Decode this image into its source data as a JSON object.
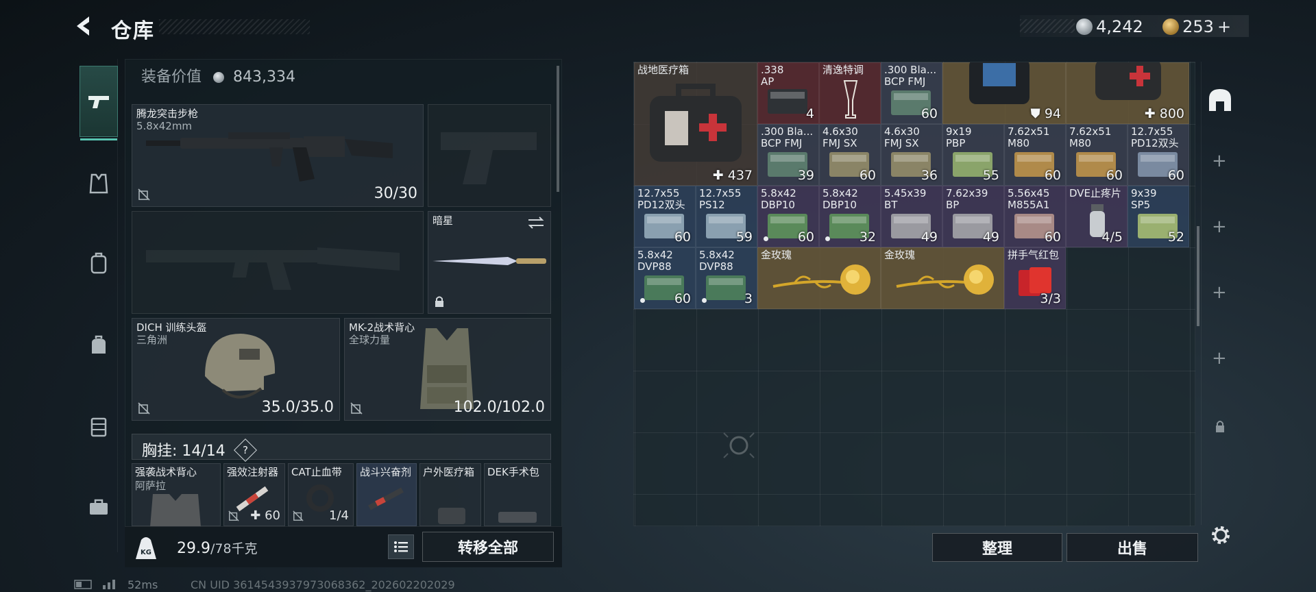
{
  "header": {
    "title": "仓库",
    "currency_silver": "4,242",
    "currency_gold": "253",
    "add_label": "+"
  },
  "nav": {
    "items": [
      "weapon-icon",
      "armor-vest-icon",
      "backpack-icon",
      "bag-icon",
      "case-icon",
      "toolbox-icon"
    ],
    "active": "weapon-icon"
  },
  "equipment": {
    "value_label": "装备价值",
    "value": "843,334",
    "primary": {
      "name": "腾龙突击步枪",
      "sub": "5.8x42mm",
      "count": "30/30"
    },
    "melee": {
      "name": "暗星"
    },
    "helmet": {
      "name": "DICH 训练头盔",
      "sub": "三角洲",
      "count": "35.0/35.0"
    },
    "vest": {
      "name": "MK-2战术背心",
      "sub": "全球力量",
      "count": "102.0/102.0"
    },
    "chest_label": "胸挂: 14/14",
    "chest_help": "?",
    "chest_items": [
      {
        "name": "强袭战术背心",
        "sub": "阿萨拉",
        "count": ""
      },
      {
        "name": "强效注射器",
        "sub": "",
        "count": "60"
      },
      {
        "name": "CAT止血带",
        "sub": "",
        "count": "1/4"
      },
      {
        "name": "战斗兴奋剂",
        "sub": "",
        "count": ""
      },
      {
        "name": "户外医疗箱",
        "sub": "",
        "count": ""
      },
      {
        "name": "DEK手术包",
        "sub": "",
        "count": ""
      }
    ],
    "weight": "29.9",
    "weight_max": "/78千克",
    "transfer_all": "转移全部"
  },
  "warehouse": {
    "items": [
      {
        "n1": "战地医疗箱",
        "n2": "",
        "count": "437",
        "icon": "plus"
      },
      {
        "n1": ".338",
        "n2": "AP",
        "count": "4"
      },
      {
        "n1": "清逸特调",
        "n2": "",
        "count": ""
      },
      {
        "n1": ".300 Bla...",
        "n2": "BCP FMJ",
        "count": "60"
      },
      {
        "n1": "",
        "n2": "",
        "count": "94",
        "icon": "shield"
      },
      {
        "n1": "",
        "n2": "",
        "count": "800",
        "icon": "plus"
      },
      {
        "n1": ".300 Bla...",
        "n2": "BCP FMJ",
        "count": "39"
      },
      {
        "n1": "4.6x30",
        "n2": "FMJ SX",
        "count": "60"
      },
      {
        "n1": "4.6x30",
        "n2": "FMJ SX",
        "count": "36"
      },
      {
        "n1": "9x19",
        "n2": "PBP",
        "count": "55"
      },
      {
        "n1": "7.62x51",
        "n2": "M80",
        "count": "60"
      },
      {
        "n1": "7.62x51",
        "n2": "M80",
        "count": "60"
      },
      {
        "n1": "12.7x55",
        "n2": "PD12双头",
        "count": "60"
      },
      {
        "n1": "12.7x55",
        "n2": "PD12双头",
        "count": "60"
      },
      {
        "n1": "12.7x55",
        "n2": "PS12",
        "count": "59"
      },
      {
        "n1": "5.8x42",
        "n2": "DBP10",
        "count": "60"
      },
      {
        "n1": "5.8x42",
        "n2": "DBP10",
        "count": "32"
      },
      {
        "n1": "5.45x39",
        "n2": "BT",
        "count": "49"
      },
      {
        "n1": "7.62x39",
        "n2": "BP",
        "count": "49"
      },
      {
        "n1": "5.56x45",
        "n2": "M855A1",
        "count": "60"
      },
      {
        "n1": "DVE止疼片",
        "n2": "",
        "count": "4/5"
      },
      {
        "n1": "9x39",
        "n2": "SP5",
        "count": "52"
      },
      {
        "n1": "5.8x42",
        "n2": "DVP88",
        "count": "60"
      },
      {
        "n1": "5.8x42",
        "n2": "DVP88",
        "count": "3"
      },
      {
        "n1": "金玫瑰",
        "n2": "",
        "count": ""
      },
      {
        "n1": "金玫瑰",
        "n2": "",
        "count": ""
      },
      {
        "n1": "拼手气红包",
        "n2": "",
        "count": "3/3"
      }
    ],
    "sort_label": "整理",
    "sell_label": "出售"
  },
  "status": {
    "ping": "52ms",
    "uid": "CN UID 3614543937973068362_202602202029"
  },
  "colors": {
    "accent": "#58c3b0",
    "panel": "#1c2a31"
  }
}
